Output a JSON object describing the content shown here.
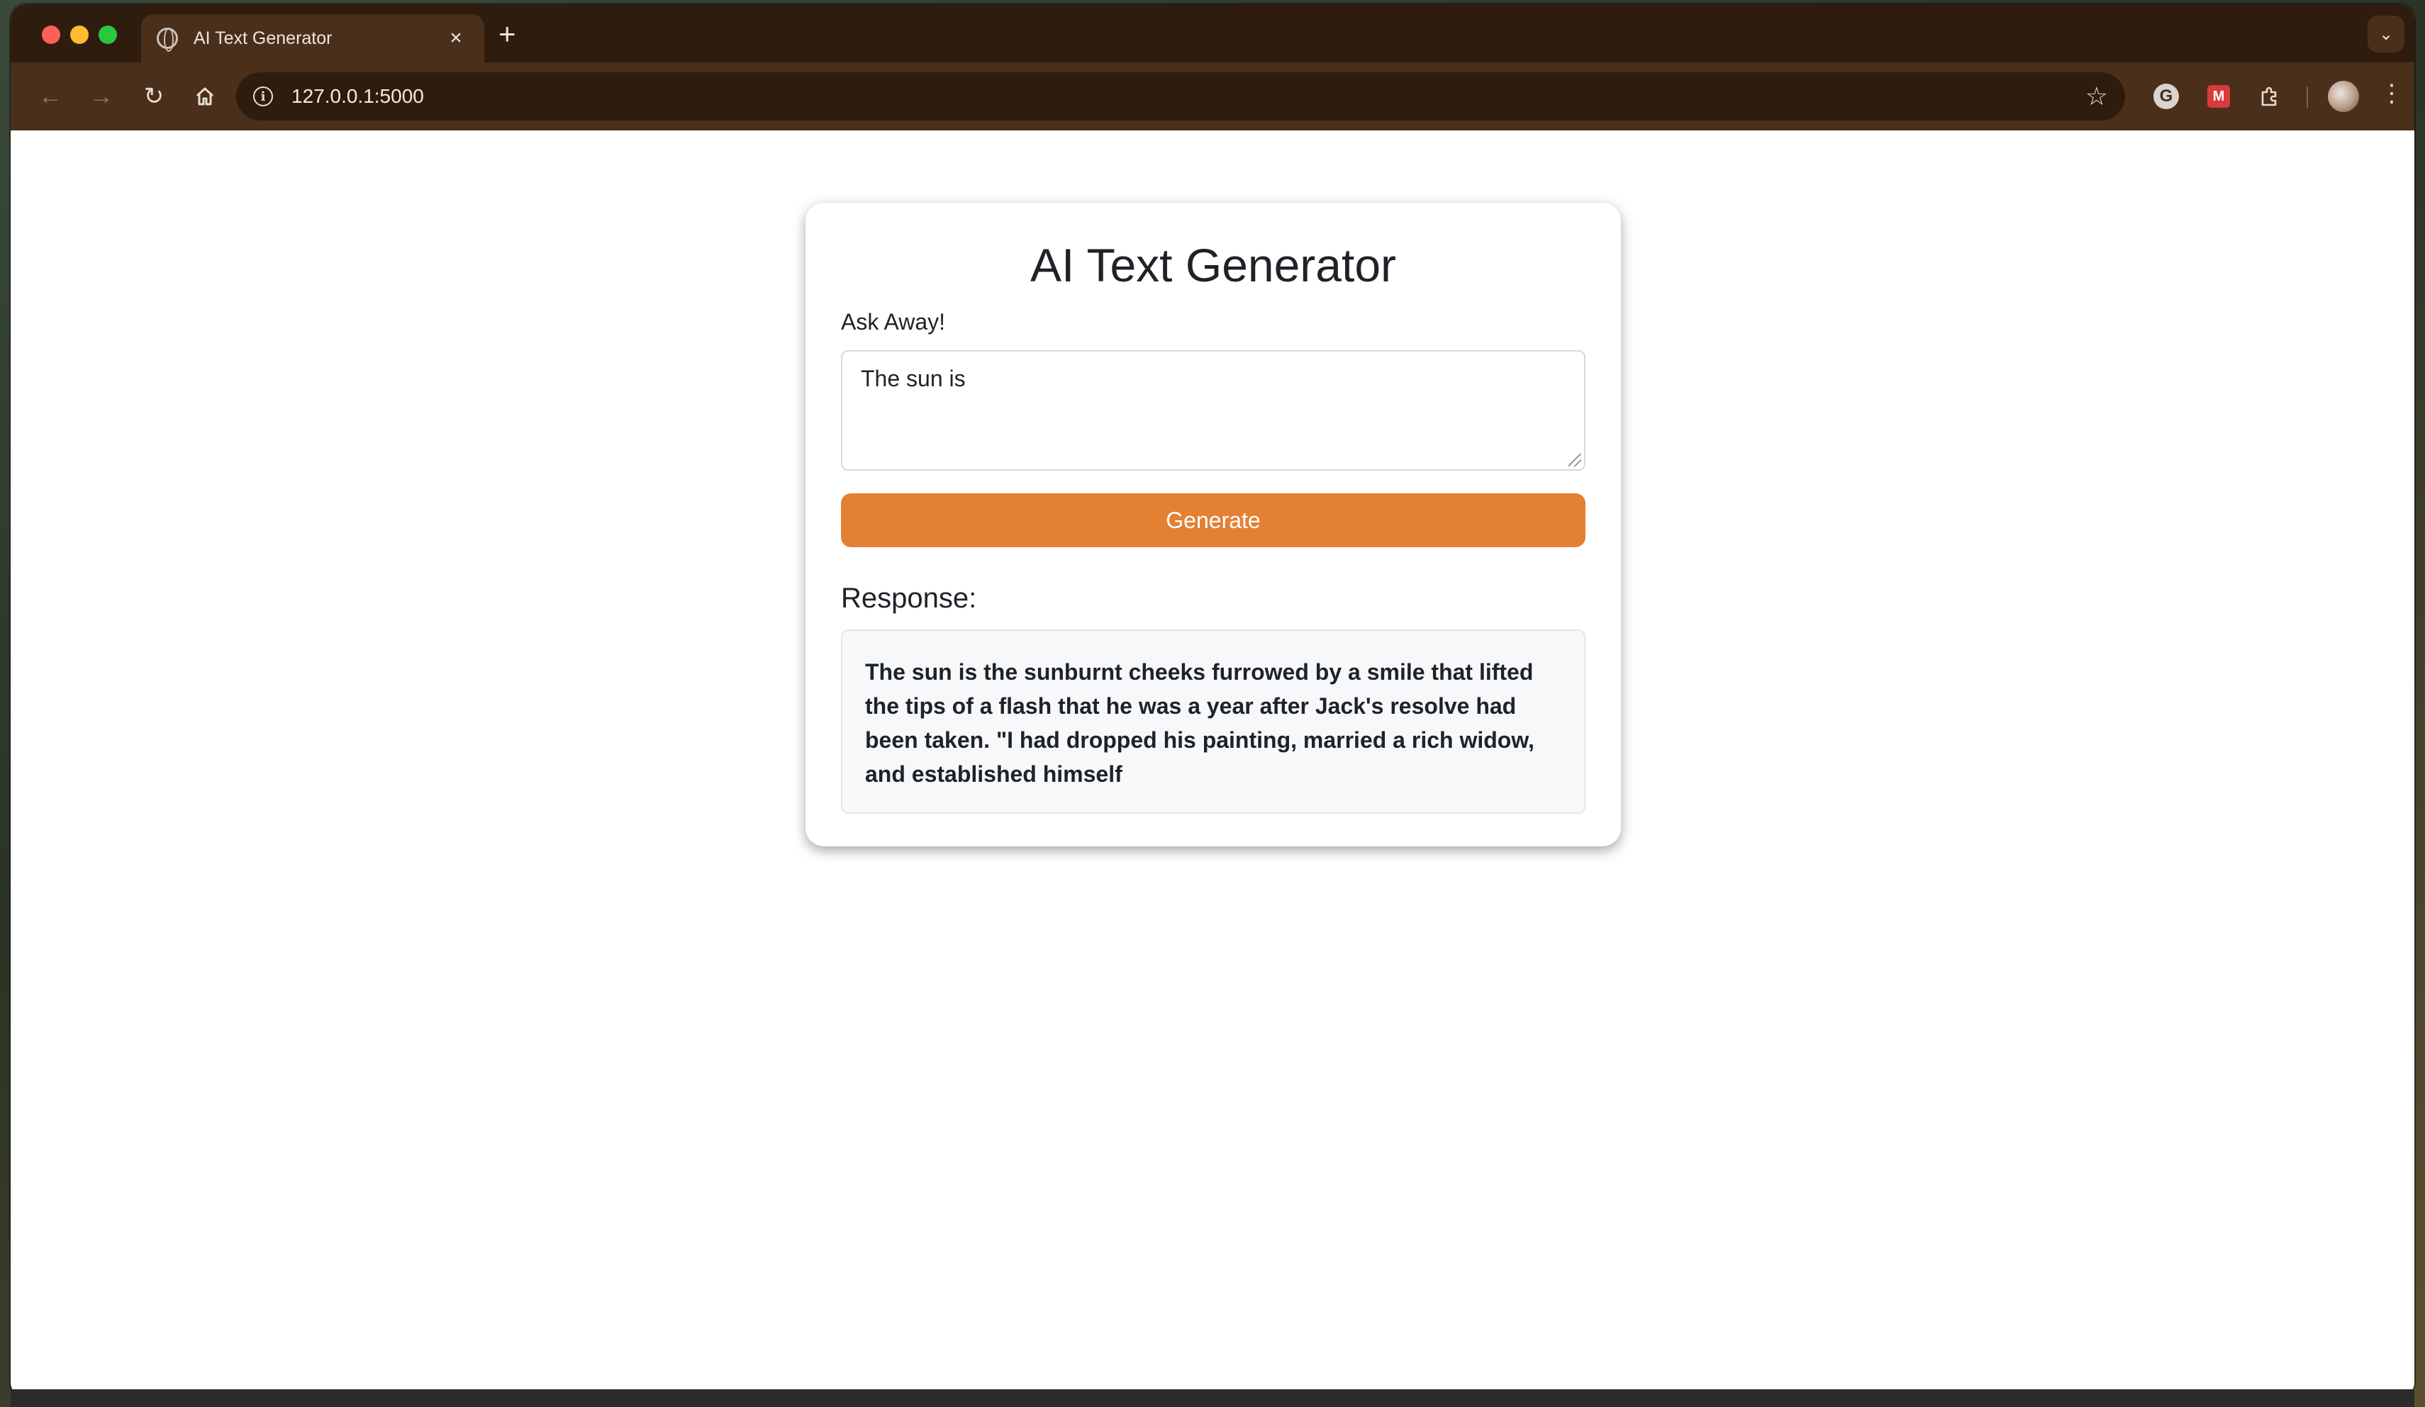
{
  "browser": {
    "tab_title": "AI Text Generator",
    "tab_close": "×",
    "new_tab": "+",
    "url": "127.0.0.1:5000"
  },
  "icons": {
    "back": "arrow-left-icon",
    "forward": "arrow-right-icon",
    "reload": "reload-icon",
    "home": "home-icon",
    "info": "info-icon",
    "bookmark": "star-icon",
    "extension_g": "grammarly-extension-icon",
    "extension_m": "red-extension-icon",
    "extensions": "puzzle-icon",
    "menu": "kebab-menu-icon"
  },
  "page": {
    "title": "AI Text Generator",
    "prompt_label": "Ask Away!",
    "prompt_value": "The sun is",
    "generate_label": "Generate",
    "response_label": "Response:",
    "response_text": "The sun is the sunburnt cheeks furrowed by a smile that lifted the tips of a flash that he was a year after Jack's resolve had been taken. \"I had dropped his painting, married a rich widow, and established himself"
  },
  "colors": {
    "accent": "#e48033",
    "browser_frame": "#2e1c0f",
    "toolbar": "#4a2f1b",
    "response_bg": "#f6f8fa"
  }
}
